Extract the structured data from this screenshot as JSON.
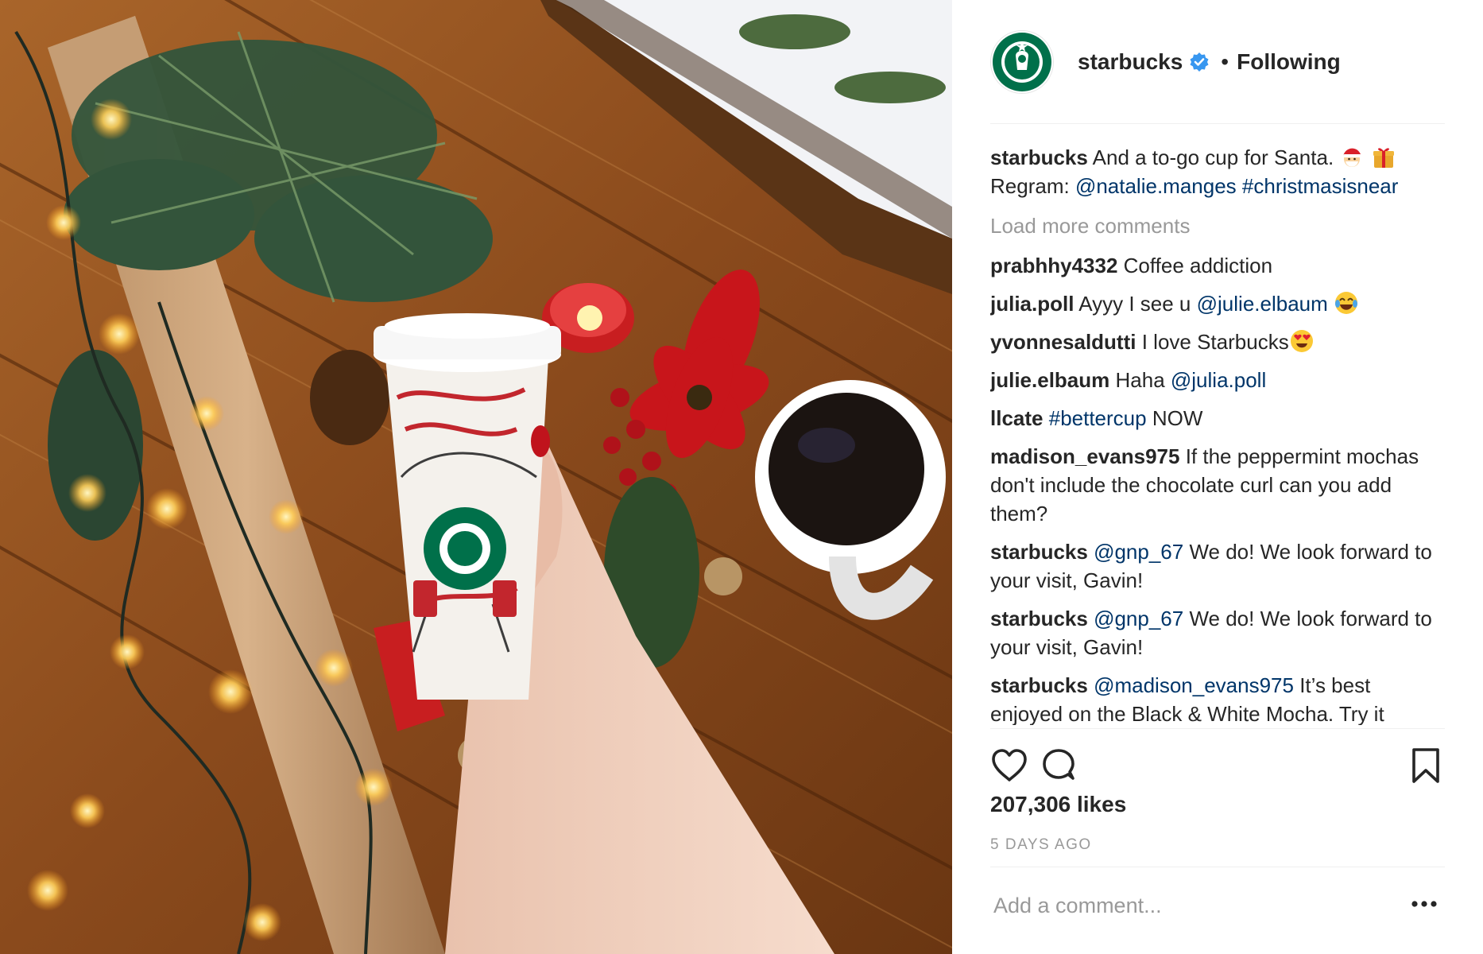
{
  "post": {
    "image_alt": "Hand holding a red-and-white holiday to-go cup on a wooden table with pine branches, string lights, a candle, poinsettia and a mug of coffee"
  },
  "header": {
    "username": "starbucks",
    "verified_icon": "verified-badge-icon",
    "separator": "•",
    "follow_state": "Following"
  },
  "caption": {
    "user": "starbucks",
    "text": "And a to-go cup for Santa.",
    "emojis": [
      "santa-emoji",
      "gift-emoji"
    ],
    "regram_label": "Regram:",
    "mention": "@natalie.manges",
    "hashtag": "#christmasisnear"
  },
  "load_more": "Load more comments",
  "comments": [
    {
      "user": "prabhhy4332",
      "text": "Coffee addiction"
    },
    {
      "user": "julia.poll",
      "text": "Ayyy I see u",
      "mention": "@julie.elbaum",
      "emoji": "tears-of-joy-emoji"
    },
    {
      "user": "yvonnesaldutti",
      "text": "I love Starbucks",
      "emoji": "heart-eyes-emoji"
    },
    {
      "user": "julie.elbaum",
      "text": "Haha",
      "mention": "@julia.poll"
    },
    {
      "user": "llcate",
      "mention": "#bettercup",
      "text_after": "NOW"
    },
    {
      "user": "madison_evans975",
      "text": "If the peppermint mochas don't include the chocolate curl can you add them?"
    },
    {
      "user": "starbucks",
      "mention": "@gnp_67",
      "text_after": "We do! We look forward to your visit, Gavin!"
    },
    {
      "user": "starbucks",
      "mention": "@gnp_67",
      "text_after": "We do! We look forward to your visit, Gavin!"
    },
    {
      "user": "starbucks",
      "mention": "@madison_evans975",
      "text_after": "It’s best enjoyed on the Black & White Mocha. Try it"
    }
  ],
  "actions": {
    "like_icon": "heart-icon",
    "comment_icon": "comment-icon",
    "save_icon": "bookmark-icon"
  },
  "likes": "207,306 likes",
  "time_ago": "5 DAYS AGO",
  "composer": {
    "placeholder": "Add a comment...",
    "more_icon": "more-options-icon"
  },
  "colors": {
    "text": "#262626",
    "muted": "#999999",
    "link": "#003569",
    "verified": "#3897f0",
    "divider": "#efefef",
    "brand_green": "#00704a"
  }
}
